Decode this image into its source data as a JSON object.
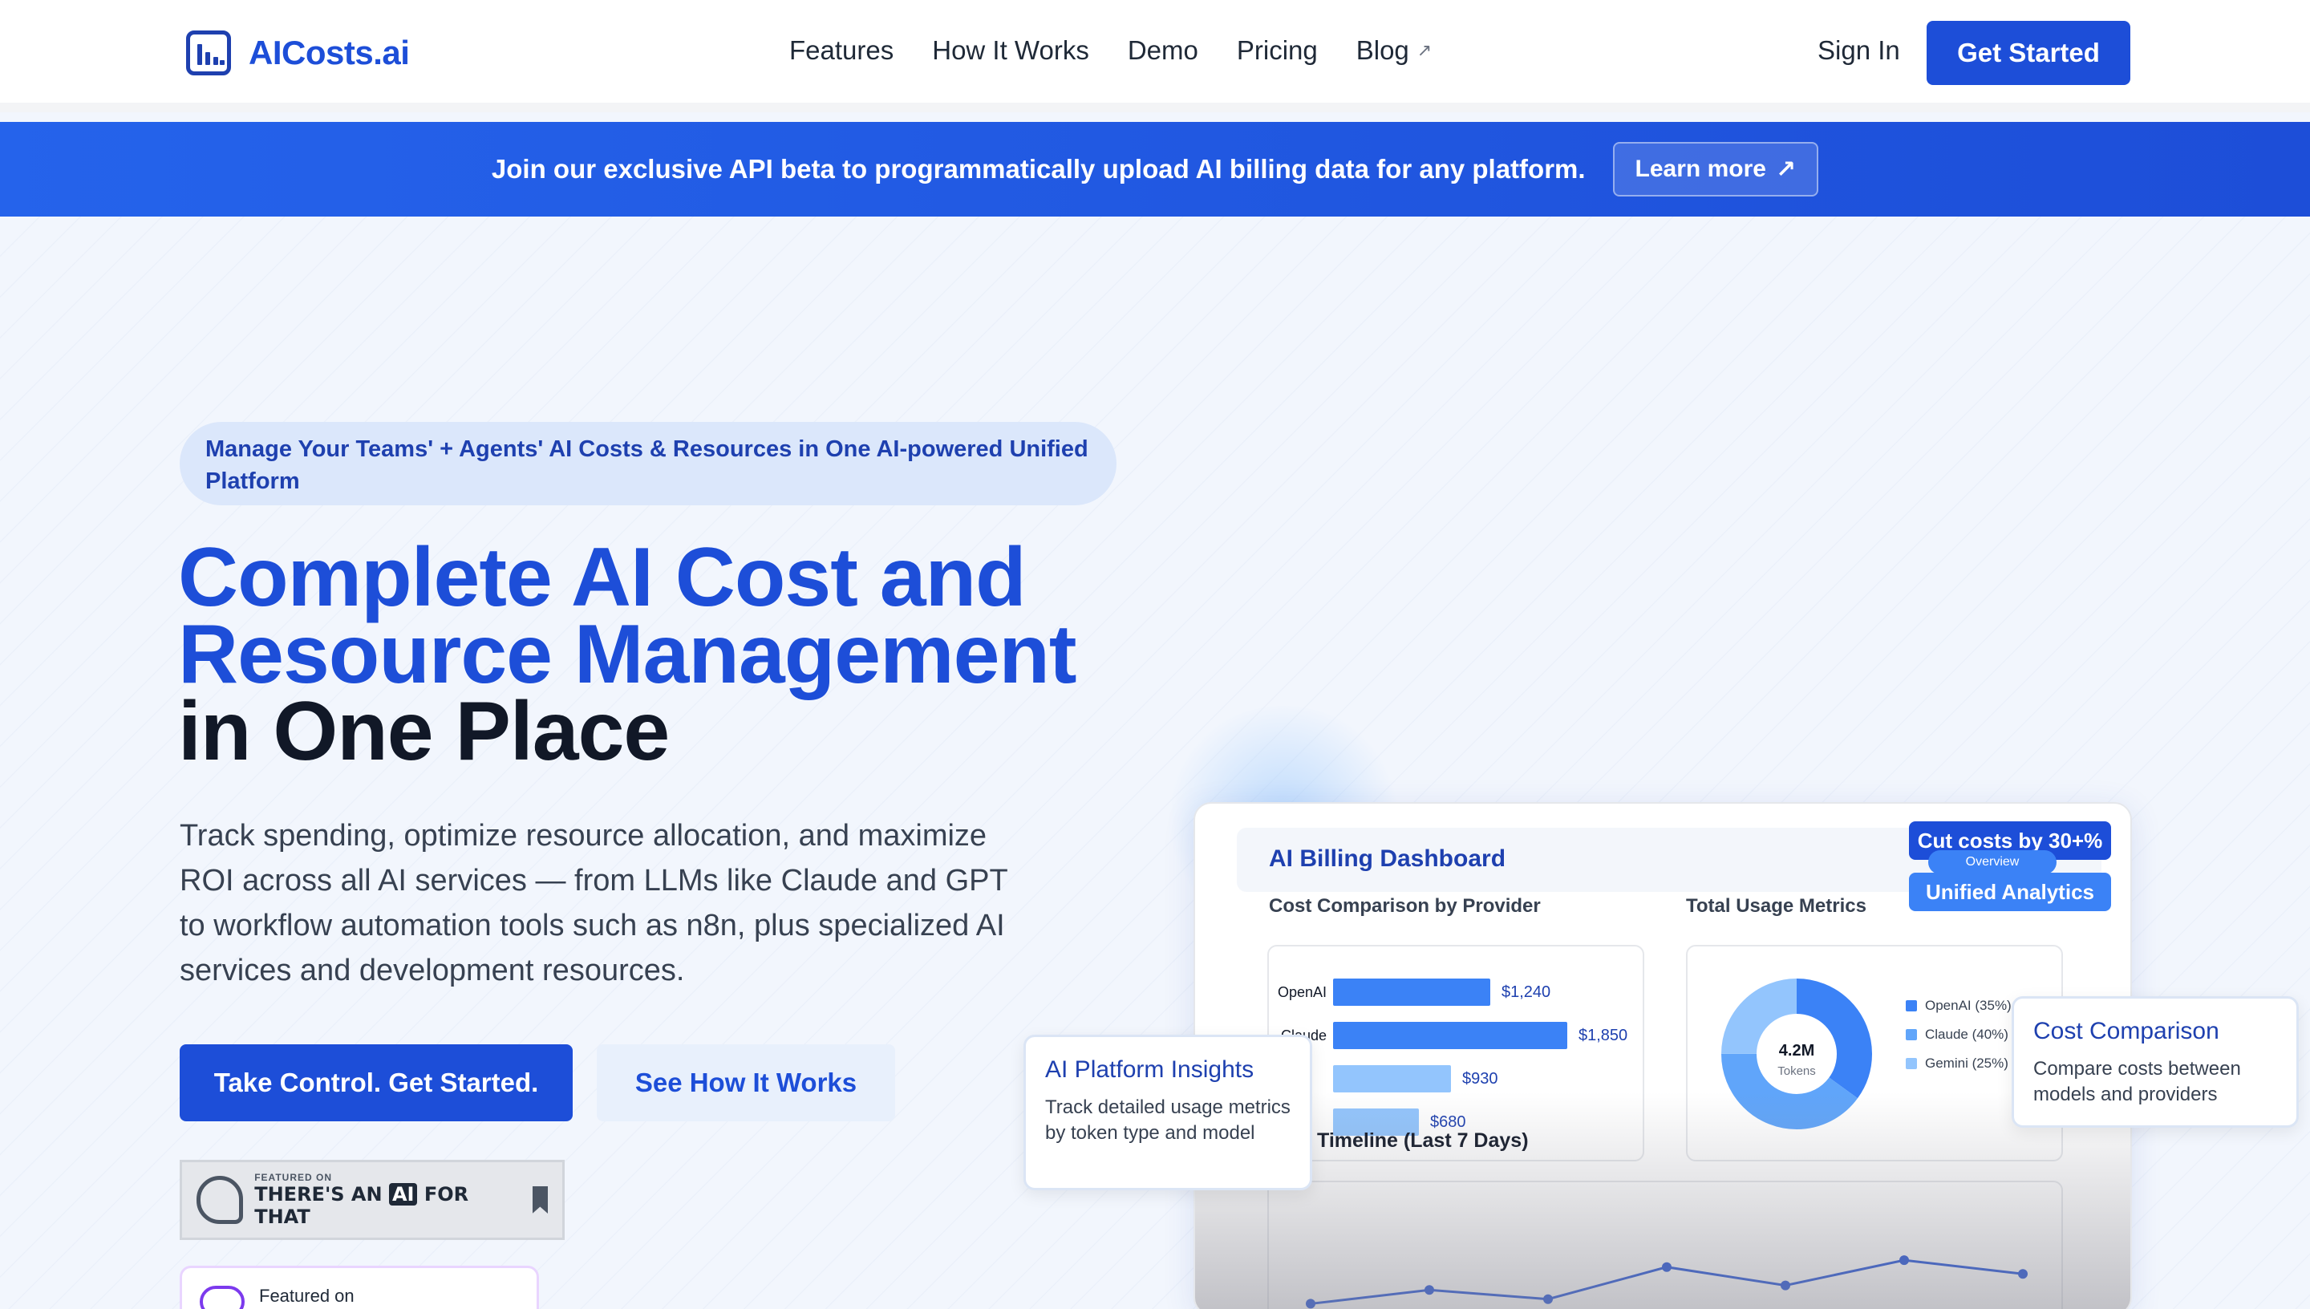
{
  "header": {
    "brand": "AICosts.ai",
    "nav": [
      "Features",
      "How It Works",
      "Demo",
      "Pricing",
      "Blog"
    ],
    "sign_in": "Sign In",
    "get_started": "Get Started"
  },
  "banner": {
    "text": "Join our exclusive API beta to programmatically upload AI billing data for any platform.",
    "button": "Learn more"
  },
  "hero": {
    "pill": "Manage Your Teams' + Agents' AI Costs & Resources in One AI-powered Unified Platform",
    "title_line1": "Complete AI Cost and",
    "title_line2": "Resource Management",
    "title_line3": "in One Place",
    "lead": "Track spending, optimize resource allocation, and maximize ROI across all AI services — from LLMs like Claude and GPT to workflow automation tools such as n8n, plus specialized AI services and development resources.",
    "cta_primary": "Take Control. Get Started.",
    "cta_secondary": "See How It Works",
    "badge1_small": "FEATURED ON",
    "badge1_pre": "THERE'S AN",
    "badge1_ai": "AI",
    "badge1_post": "FOR THAT",
    "badge2": "Featured on"
  },
  "dashboard": {
    "title": "AI Billing Dashboard",
    "cost_comparison_label": "Cost Comparison by Provider",
    "usage_label": "Total Usage Metrics",
    "timeline_label": "Timeline (Last 7 Days)",
    "tag_cut": "Cut costs by 30+%",
    "tag_overview": "Overview",
    "tag_unified": "Unified Analytics",
    "donut_value": "4.2M",
    "donut_unit": "Tokens",
    "colors": {
      "primary": "#1d4ed8",
      "blue500": "#3b82f6",
      "blue400": "#60a5fa",
      "blue300": "#93c5fd"
    }
  },
  "float_insights": {
    "title": "AI Platform Insights",
    "desc": "Track detailed usage metrics by token type and model"
  },
  "float_comparison": {
    "title": "Cost Comparison",
    "desc": "Compare costs between models and providers"
  },
  "chart_data": [
    {
      "type": "bar",
      "title": "Cost Comparison by Provider",
      "categories": [
        "OpenAI",
        "Claude",
        "",
        ""
      ],
      "values": [
        1240,
        1850,
        930,
        680
      ],
      "value_labels": [
        "$1,240",
        "$1,850",
        "$930",
        "$680"
      ],
      "orientation": "horizontal"
    },
    {
      "type": "pie",
      "title": "Total Usage Metrics",
      "center_label": "4.2M",
      "center_sublabel": "Tokens",
      "slices": [
        {
          "label": "OpenAI (35%)",
          "value": 35,
          "color": "#3b82f6"
        },
        {
          "label": "Claude (40%)",
          "value": 40,
          "color": "#60a5fa"
        },
        {
          "label": "Gemini (25%)",
          "value": 25,
          "color": "#93c5fd"
        }
      ]
    },
    {
      "type": "line",
      "title": "Timeline (Last 7 Days)",
      "x": [
        1,
        2,
        3,
        4,
        5,
        6,
        7
      ],
      "y": [
        20,
        32,
        24,
        52,
        36,
        58,
        46
      ]
    }
  ]
}
